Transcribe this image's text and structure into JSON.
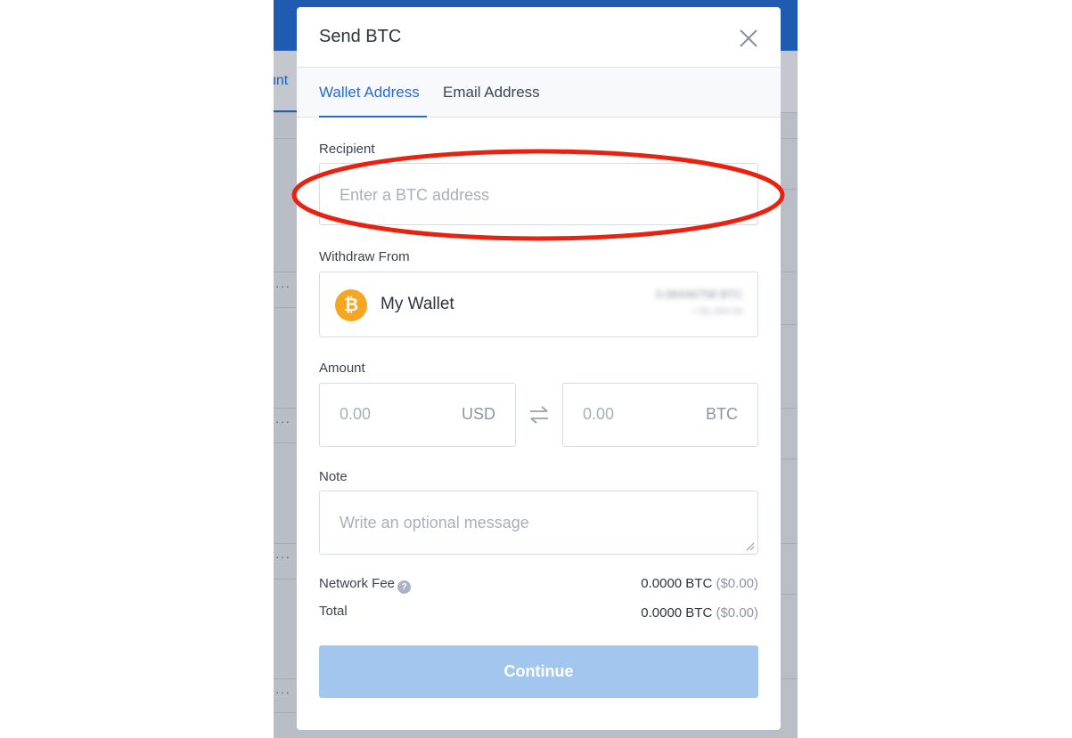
{
  "background": {
    "partial_tab_label": "unt",
    "row_menu_dots": "···"
  },
  "modal": {
    "title": "Send BTC",
    "close_icon": "close-icon",
    "tabs": [
      {
        "label": "Wallet Address",
        "active": true
      },
      {
        "label": "Email Address",
        "active": false
      }
    ],
    "recipient": {
      "label": "Recipient",
      "placeholder": "Enter a BTC address"
    },
    "withdraw_from": {
      "label": "Withdraw From",
      "wallet_name": "My Wallet",
      "wallet_icon": "bitcoin-icon",
      "balance_btc": "0.08446758 BTC",
      "balance_fiat": "≈ $1,064.00"
    },
    "amount": {
      "label": "Amount",
      "fiat_placeholder": "0.00",
      "fiat_currency": "USD",
      "swap_icon": "swap-icon",
      "crypto_placeholder": "0.00",
      "crypto_currency": "BTC"
    },
    "note": {
      "label": "Note",
      "placeholder": "Write an optional message"
    },
    "network_fee": {
      "label": "Network Fee",
      "help_icon": "help-icon",
      "help_glyph": "?",
      "btc": "0.0000 BTC",
      "fiat": "($0.00)"
    },
    "total": {
      "label": "Total",
      "btc": "0.0000 BTC",
      "fiat": "($0.00)"
    },
    "continue_label": "Continue"
  },
  "colors": {
    "accent": "#2a6ad1",
    "continue_disabled": "#a3c6ef",
    "bitcoin_orange": "#f5a623",
    "annotation_red": "#e8220e"
  }
}
